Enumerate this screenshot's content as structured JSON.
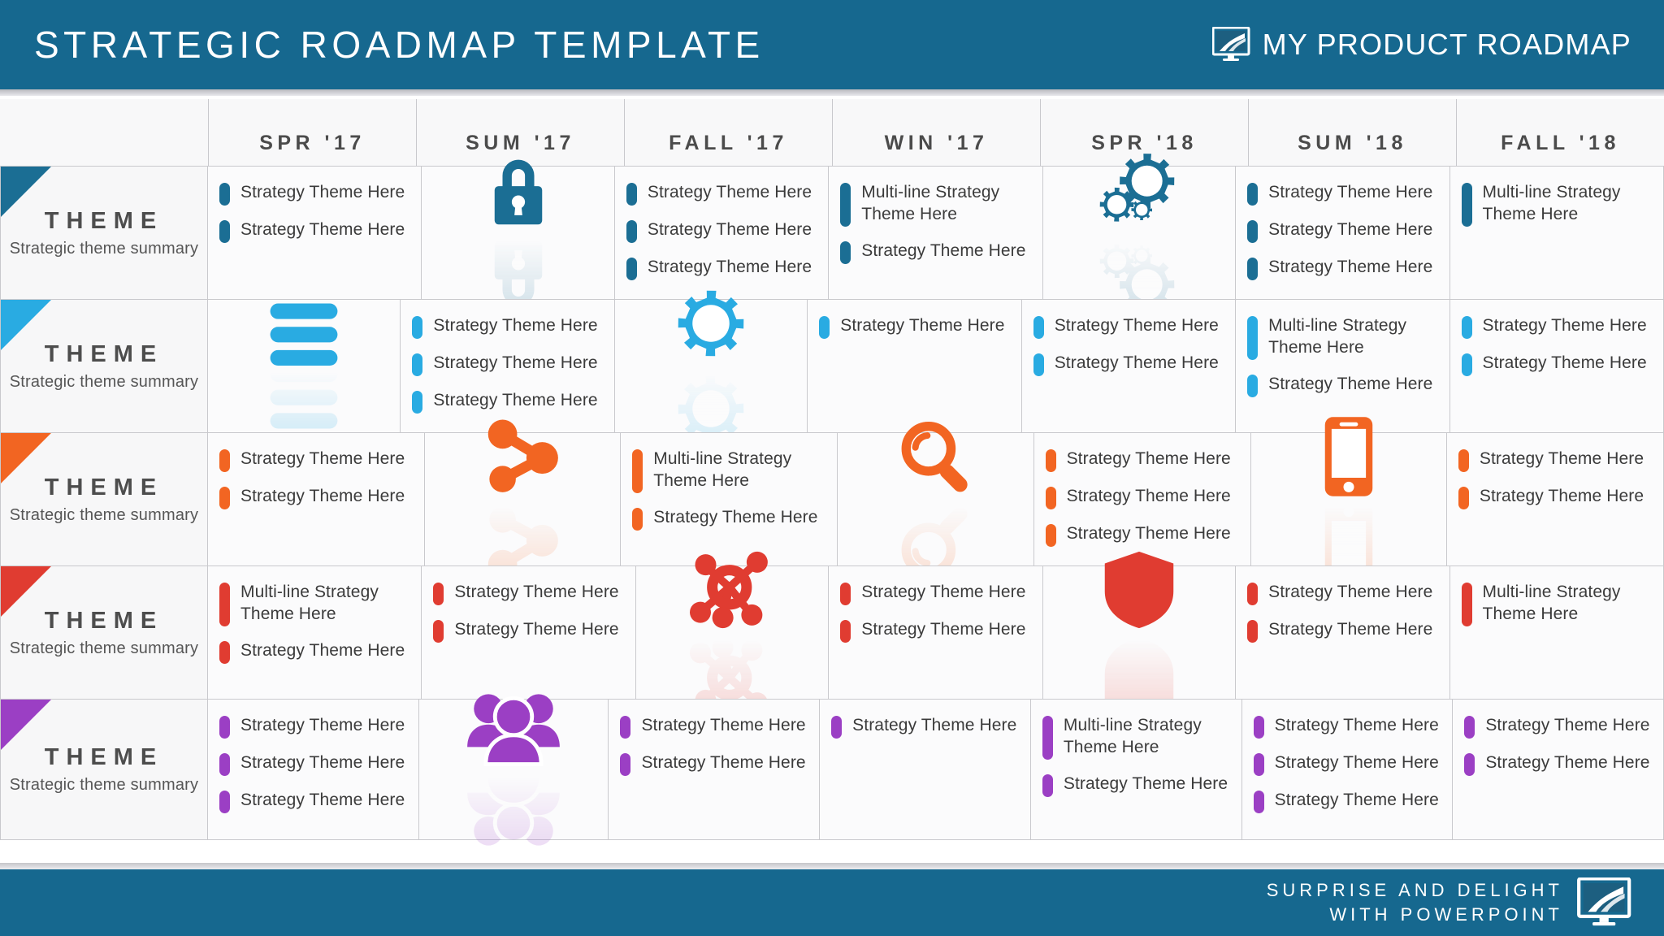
{
  "header": {
    "title": "STRATEGIC ROADMAP TEMPLATE",
    "brand_label": "MY PRODUCT  ROADMAP",
    "logo_icon": "monitor-road-logo",
    "bg_color": "#16688f"
  },
  "footer": {
    "line1": "SURPRISE AND DELIGHT",
    "line2": "WITH POWERPOINT",
    "logo_icon": "monitor-road-logo"
  },
  "columns": [
    {
      "label": "SPR '17"
    },
    {
      "label": "SUM '17"
    },
    {
      "label": "FALL '17"
    },
    {
      "label": "WIN '17"
    },
    {
      "label": "SPR '18"
    },
    {
      "label": "SUM '18"
    },
    {
      "label": "FALL '18"
    }
  ],
  "theme_label": "THEME",
  "theme_summary": "Strategic theme summary",
  "item_label": "Strategy Theme Here",
  "item_label_multi": "Multi-line Strategy Theme Here",
  "rows": [
    {
      "color": "#1b6e94",
      "title": "THEME",
      "summary": "Strategic theme summary",
      "cells": [
        {
          "type": "items",
          "items": [
            {
              "text": "Strategy Theme Here",
              "multi": false
            },
            {
              "text": "Strategy Theme Here",
              "multi": false
            }
          ]
        },
        {
          "type": "icon",
          "icon": "lock-icon"
        },
        {
          "type": "items",
          "items": [
            {
              "text": "Strategy Theme Here",
              "multi": false
            },
            {
              "text": "Strategy Theme Here",
              "multi": false
            },
            {
              "text": "Strategy Theme Here",
              "multi": false
            }
          ]
        },
        {
          "type": "items",
          "items": [
            {
              "text": "Multi-line Strategy Theme Here",
              "multi": true
            },
            {
              "text": "Strategy Theme Here",
              "multi": false
            }
          ]
        },
        {
          "type": "icon",
          "icon": "gears-icon"
        },
        {
          "type": "items",
          "items": [
            {
              "text": "Strategy Theme Here",
              "multi": false
            },
            {
              "text": "Strategy Theme Here",
              "multi": false
            },
            {
              "text": "Strategy Theme Here",
              "multi": false
            }
          ]
        },
        {
          "type": "items",
          "items": [
            {
              "text": "Multi-line Strategy Theme Here",
              "multi": true
            }
          ]
        }
      ]
    },
    {
      "color": "#29abe2",
      "title": "THEME",
      "summary": "Strategic theme summary",
      "cells": [
        {
          "type": "icon",
          "icon": "menu-icon"
        },
        {
          "type": "items",
          "items": [
            {
              "text": "Strategy Theme Here",
              "multi": false
            },
            {
              "text": "Strategy Theme Here",
              "multi": false
            },
            {
              "text": "Strategy Theme Here",
              "multi": false
            }
          ]
        },
        {
          "type": "icon",
          "icon": "gear-icon"
        },
        {
          "type": "items",
          "items": [
            {
              "text": "Strategy Theme Here",
              "multi": false
            }
          ]
        },
        {
          "type": "items",
          "items": [
            {
              "text": "Strategy Theme Here",
              "multi": false
            },
            {
              "text": "Strategy Theme Here",
              "multi": false
            }
          ]
        },
        {
          "type": "items",
          "items": [
            {
              "text": "Multi-line Strategy Theme Here",
              "multi": true
            },
            {
              "text": "Strategy Theme Here",
              "multi": false
            }
          ]
        },
        {
          "type": "items",
          "items": [
            {
              "text": "Strategy Theme Here",
              "multi": false
            },
            {
              "text": "Strategy Theme Here",
              "multi": false
            }
          ]
        }
      ]
    },
    {
      "color": "#f26522",
      "title": "THEME",
      "summary": "Strategic theme summary",
      "cells": [
        {
          "type": "items",
          "items": [
            {
              "text": "Strategy Theme Here",
              "multi": false
            },
            {
              "text": "Strategy Theme Here",
              "multi": false
            }
          ]
        },
        {
          "type": "icon",
          "icon": "share-nodes-icon"
        },
        {
          "type": "items",
          "items": [
            {
              "text": "Multi-line Strategy Theme Here",
              "multi": true
            },
            {
              "text": "Strategy Theme Here",
              "multi": false
            }
          ]
        },
        {
          "type": "icon",
          "icon": "magnifier-icon"
        },
        {
          "type": "items",
          "items": [
            {
              "text": "Strategy Theme Here",
              "multi": false
            },
            {
              "text": "Strategy Theme Here",
              "multi": false
            },
            {
              "text": "Strategy Theme Here",
              "multi": false
            }
          ]
        },
        {
          "type": "icon",
          "icon": "smartphone-icon"
        },
        {
          "type": "items",
          "items": [
            {
              "text": "Strategy Theme Here",
              "multi": false
            },
            {
              "text": "Strategy Theme Here",
              "multi": false
            }
          ]
        }
      ]
    },
    {
      "color": "#e03c31",
      "title": "THEME",
      "summary": "Strategic theme summary",
      "cells": [
        {
          "type": "items",
          "items": [
            {
              "text": "Multi-line Strategy Theme Here",
              "multi": true
            },
            {
              "text": "Strategy Theme Here",
              "multi": false
            }
          ]
        },
        {
          "type": "items",
          "items": [
            {
              "text": "Strategy Theme Here",
              "multi": false
            },
            {
              "text": "Strategy Theme Here",
              "multi": false
            }
          ]
        },
        {
          "type": "icon",
          "icon": "network-hub-icon"
        },
        {
          "type": "items",
          "items": [
            {
              "text": "Strategy Theme Here",
              "multi": false
            },
            {
              "text": "Strategy Theme Here",
              "multi": false
            }
          ]
        },
        {
          "type": "icon",
          "icon": "shield-icon"
        },
        {
          "type": "items",
          "items": [
            {
              "text": "Strategy Theme Here",
              "multi": false
            },
            {
              "text": "Strategy Theme Here",
              "multi": false
            }
          ]
        },
        {
          "type": "items",
          "items": [
            {
              "text": "Multi-line Strategy Theme Here",
              "multi": true
            }
          ]
        }
      ]
    },
    {
      "color": "#9b3fc4",
      "title": "THEME",
      "summary": "Strategic theme summary",
      "cells": [
        {
          "type": "items",
          "items": [
            {
              "text": "Strategy Theme Here",
              "multi": false
            },
            {
              "text": "Strategy Theme Here",
              "multi": false
            },
            {
              "text": "Strategy Theme Here",
              "multi": false
            }
          ]
        },
        {
          "type": "icon",
          "icon": "people-group-icon"
        },
        {
          "type": "items",
          "items": [
            {
              "text": "Strategy Theme Here",
              "multi": false
            },
            {
              "text": "Strategy Theme Here",
              "multi": false
            }
          ]
        },
        {
          "type": "items",
          "items": [
            {
              "text": "Strategy Theme Here",
              "multi": false
            }
          ]
        },
        {
          "type": "items",
          "items": [
            {
              "text": "Multi-line Strategy Theme Here",
              "multi": true
            },
            {
              "text": "Strategy Theme Here",
              "multi": false
            }
          ]
        },
        {
          "type": "items",
          "items": [
            {
              "text": "Strategy Theme Here",
              "multi": false
            },
            {
              "text": "Strategy Theme Here",
              "multi": false
            },
            {
              "text": "Strategy Theme Here",
              "multi": false
            }
          ]
        },
        {
          "type": "items",
          "items": [
            {
              "text": "Strategy Theme Here",
              "multi": false
            },
            {
              "text": "Strategy Theme Here",
              "multi": false
            }
          ]
        }
      ]
    }
  ]
}
